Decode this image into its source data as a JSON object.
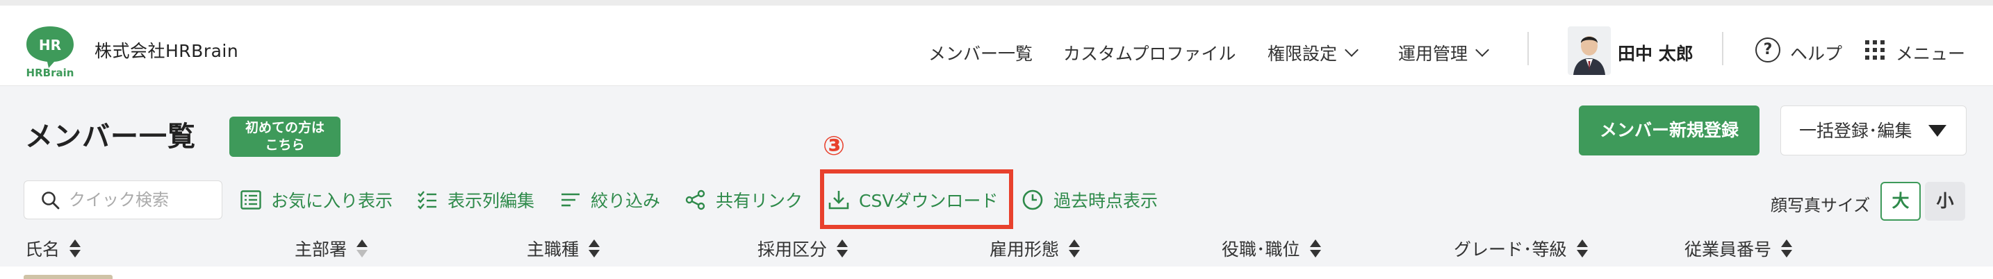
{
  "header": {
    "logo_text_top": "HR",
    "logo_text_bottom": "HRBrain",
    "company_name": "株式会社HRBrain",
    "nav": [
      {
        "label": "メンバー一覧"
      },
      {
        "label": "カスタムプロファイル"
      },
      {
        "label": "権限設定"
      },
      {
        "label": "運用管理"
      }
    ],
    "user_name": "田中 太郎",
    "help_label": "ヘルプ",
    "help_icon": "?",
    "menu_label": "メニュー"
  },
  "page": {
    "title": "メンバー一覧",
    "first_badge": [
      "初めての方は",
      "こちら"
    ],
    "new_member_button": "メンバー新規登録",
    "bulk_button": "一括登録･編集",
    "annotation_number": "③"
  },
  "toolbar": {
    "search_placeholder": "クイック検索",
    "favorites": "お気に入り表示",
    "columns_edit": "表示列編集",
    "filter": "絞り込み",
    "share_link": "共有リンク",
    "csv_download": "CSVダウンロード",
    "past_view": "過去時点表示",
    "photo_size_label": "顔写真サイズ",
    "size_large": "大",
    "size_small": "小"
  },
  "columns": [
    "氏名",
    "主部署",
    "主職種",
    "採用区分",
    "雇用形態",
    "役職･職位",
    "グレード･等級",
    "従業員番号"
  ],
  "colors": {
    "brand_green": "#3e9a5a",
    "link_green": "#2e8a4a",
    "highlight_red": "#e8412d",
    "band_gray": "#f3f4f6"
  }
}
